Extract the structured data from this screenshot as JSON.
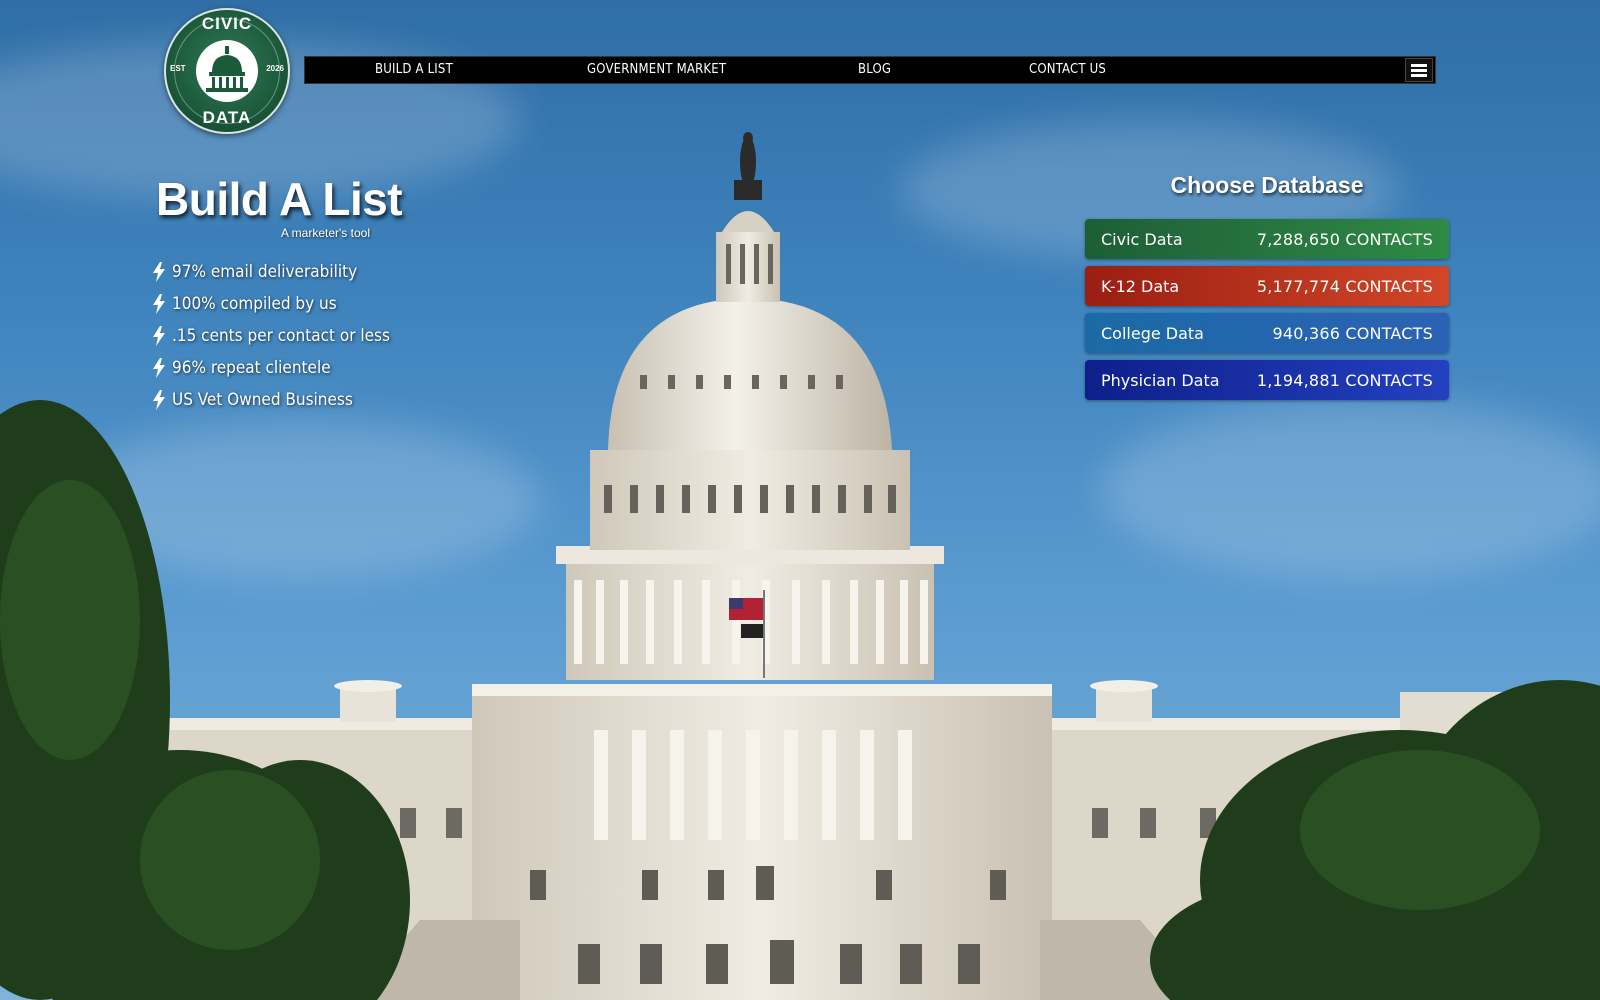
{
  "logo": {
    "top_text": "CIVIC",
    "bottom_text": "DATA",
    "est": "EST",
    "year": "2026"
  },
  "nav": {
    "items": [
      {
        "label": "BUILD A LIST"
      },
      {
        "label": "GOVERNMENT MARKET"
      },
      {
        "label": "BLOG"
      },
      {
        "label": "CONTACT US"
      }
    ],
    "menu_icon": "hamburger-menu-icon"
  },
  "hero": {
    "title": "Build A List",
    "subtitle": "A marketer's tool",
    "features": [
      "97% email deliverability",
      "100% compiled by us",
      ".15 cents per contact or less",
      "96% repeat clientele",
      "US Vet Owned Business"
    ],
    "feature_icon": "lightning-bolt-icon"
  },
  "databases": {
    "title": "Choose Database",
    "rows": [
      {
        "name": "Civic Data",
        "count": "7,288,650 CONTACTS",
        "color_start": "#1d5e36",
        "color_end": "#2f8a45"
      },
      {
        "name": "K-12 Data",
        "count": "5,177,774 CONTACTS",
        "color_start": "#9a1e12",
        "color_end": "#d24628"
      },
      {
        "name": "College Data",
        "count": "940,366 CONTACTS",
        "color_start": "#1b6aa6",
        "color_end": "#2c62b4"
      },
      {
        "name": "Physician Data",
        "count": "1,194,881 CONTACTS",
        "color_start": "#0e1f8a",
        "color_end": "#2340c0"
      }
    ]
  },
  "colors": {
    "nav_bg": "#000000",
    "sky": "#3f83bd",
    "foliage": "#1f3d1a",
    "building": "#e6e1d6"
  }
}
